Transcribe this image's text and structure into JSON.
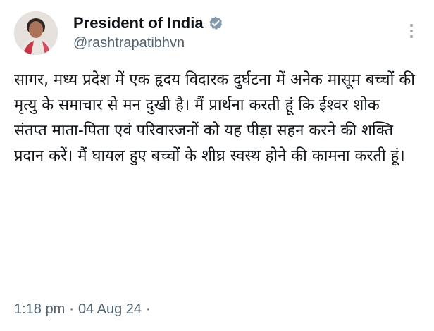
{
  "author": {
    "display_name": "President of India",
    "handle": "@rashtrapatibhvn",
    "verified_icon": "verified-badge-icon (grey)"
  },
  "tweet": {
    "text": "सागर, मध्य प्रदेश में एक हृदय विदारक दुर्घटना में अनेक मासूम बच्चों की मृत्यु के समाचार से मन दुखी है। मैं प्रार्थना करती हूं कि ईश्वर शोक संतप्त माता-पिता एवं परिवारजनों को यह पीड़ा सहन करने की शक्ति प्रदान करें। मैं घायल हुए बच्चों के शीघ्र स्वस्थ होने की कामना करती हूं।",
    "time": "1:18 pm",
    "separator": "·",
    "date": "04 Aug 24",
    "trailing_separator": "·"
  },
  "colors": {
    "text_primary": "#0f1419",
    "text_secondary": "#536471",
    "verified_badge": "#829aab",
    "background": "#ffffff"
  }
}
